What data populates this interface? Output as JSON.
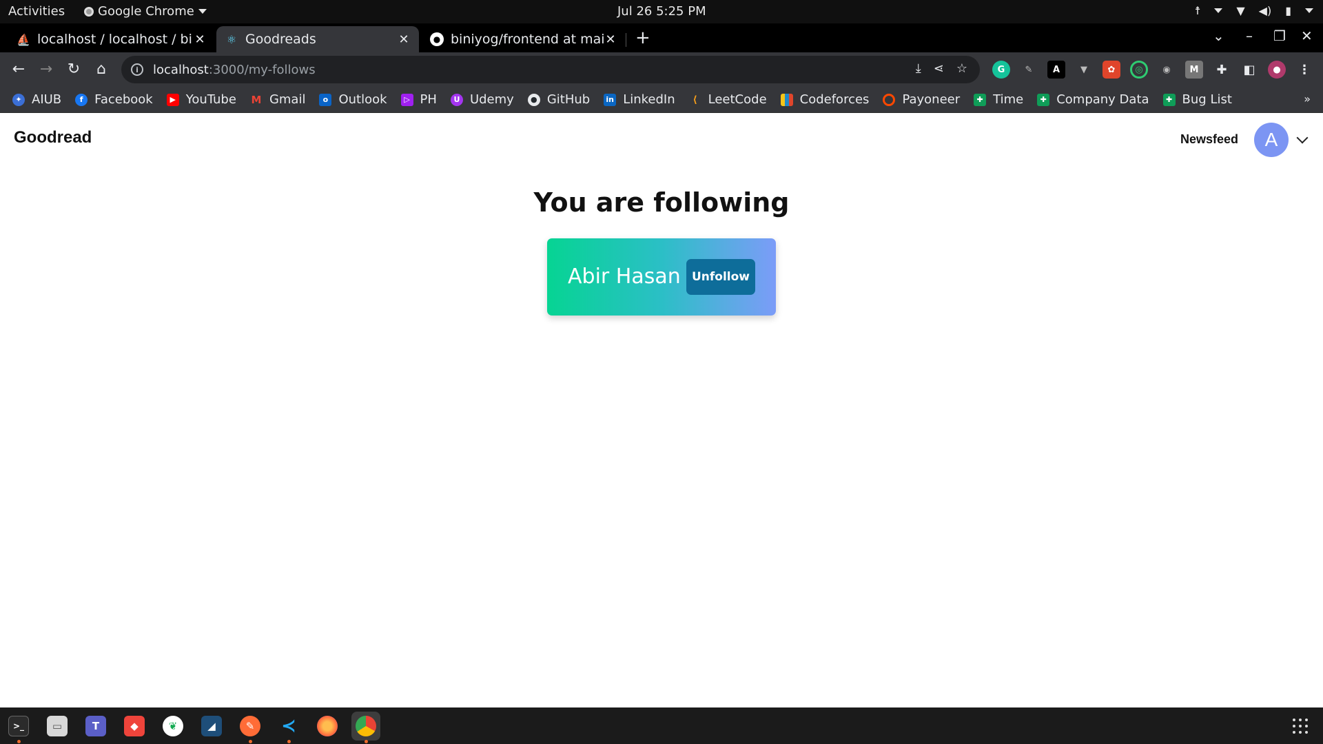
{
  "system": {
    "activities": "Activities",
    "app_name": "Google Chrome",
    "clock": "Jul 26  5:25 PM"
  },
  "tabs": [
    {
      "title": "localhost / localhost / bini",
      "icon": "phpmyadmin-icon",
      "active": false
    },
    {
      "title": "Goodreads",
      "icon": "react-icon",
      "active": true
    },
    {
      "title": "biniyog/frontend at main",
      "icon": "github-icon",
      "active": false
    }
  ],
  "address_bar": {
    "host": "localhost",
    "path": ":3000/my-follows"
  },
  "bookmarks": [
    {
      "label": "AIUB",
      "icon": "aiub-icon",
      "color": "#3b6fd6"
    },
    {
      "label": "Facebook",
      "icon": "facebook-icon",
      "color": "#1877f2"
    },
    {
      "label": "YouTube",
      "icon": "youtube-icon",
      "color": "#ff0000"
    },
    {
      "label": "Gmail",
      "icon": "gmail-icon",
      "color": "#ea4335"
    },
    {
      "label": "Outlook",
      "icon": "outlook-icon",
      "color": "#0a64c8"
    },
    {
      "label": "PH",
      "icon": "ph-icon",
      "color": "#a020f0"
    },
    {
      "label": "Udemy",
      "icon": "udemy-icon",
      "color": "#a435f0"
    },
    {
      "label": "GitHub",
      "icon": "github-icon",
      "color": "#24292e"
    },
    {
      "label": "LinkedIn",
      "icon": "linkedin-icon",
      "color": "#0a66c2"
    },
    {
      "label": "LeetCode",
      "icon": "leetcode-icon",
      "color": "#f89f1b"
    },
    {
      "label": "Codeforces",
      "icon": "codeforces-icon",
      "color": "#1f8acb"
    },
    {
      "label": "Payoneer",
      "icon": "payoneer-icon",
      "color": "#ff4800"
    },
    {
      "label": "Time",
      "icon": "sheets-icon",
      "color": "#0f9d58"
    },
    {
      "label": "Company Data",
      "icon": "sheets-icon",
      "color": "#0f9d58"
    },
    {
      "label": "Bug List",
      "icon": "sheets-icon",
      "color": "#0f9d58"
    }
  ],
  "app": {
    "brand": "Goodread",
    "nav_newsfeed": "Newsfeed",
    "avatar_initial": "A",
    "heading": "You are following",
    "follows": [
      {
        "name": "Abir Hasan",
        "action": "Unfollow"
      }
    ]
  },
  "colors": {
    "card_gradient_start": "#06d493",
    "card_gradient_end": "#7c9cf8",
    "button_bg": "#0e6d9a",
    "avatar_bg": "#7c95f3"
  }
}
